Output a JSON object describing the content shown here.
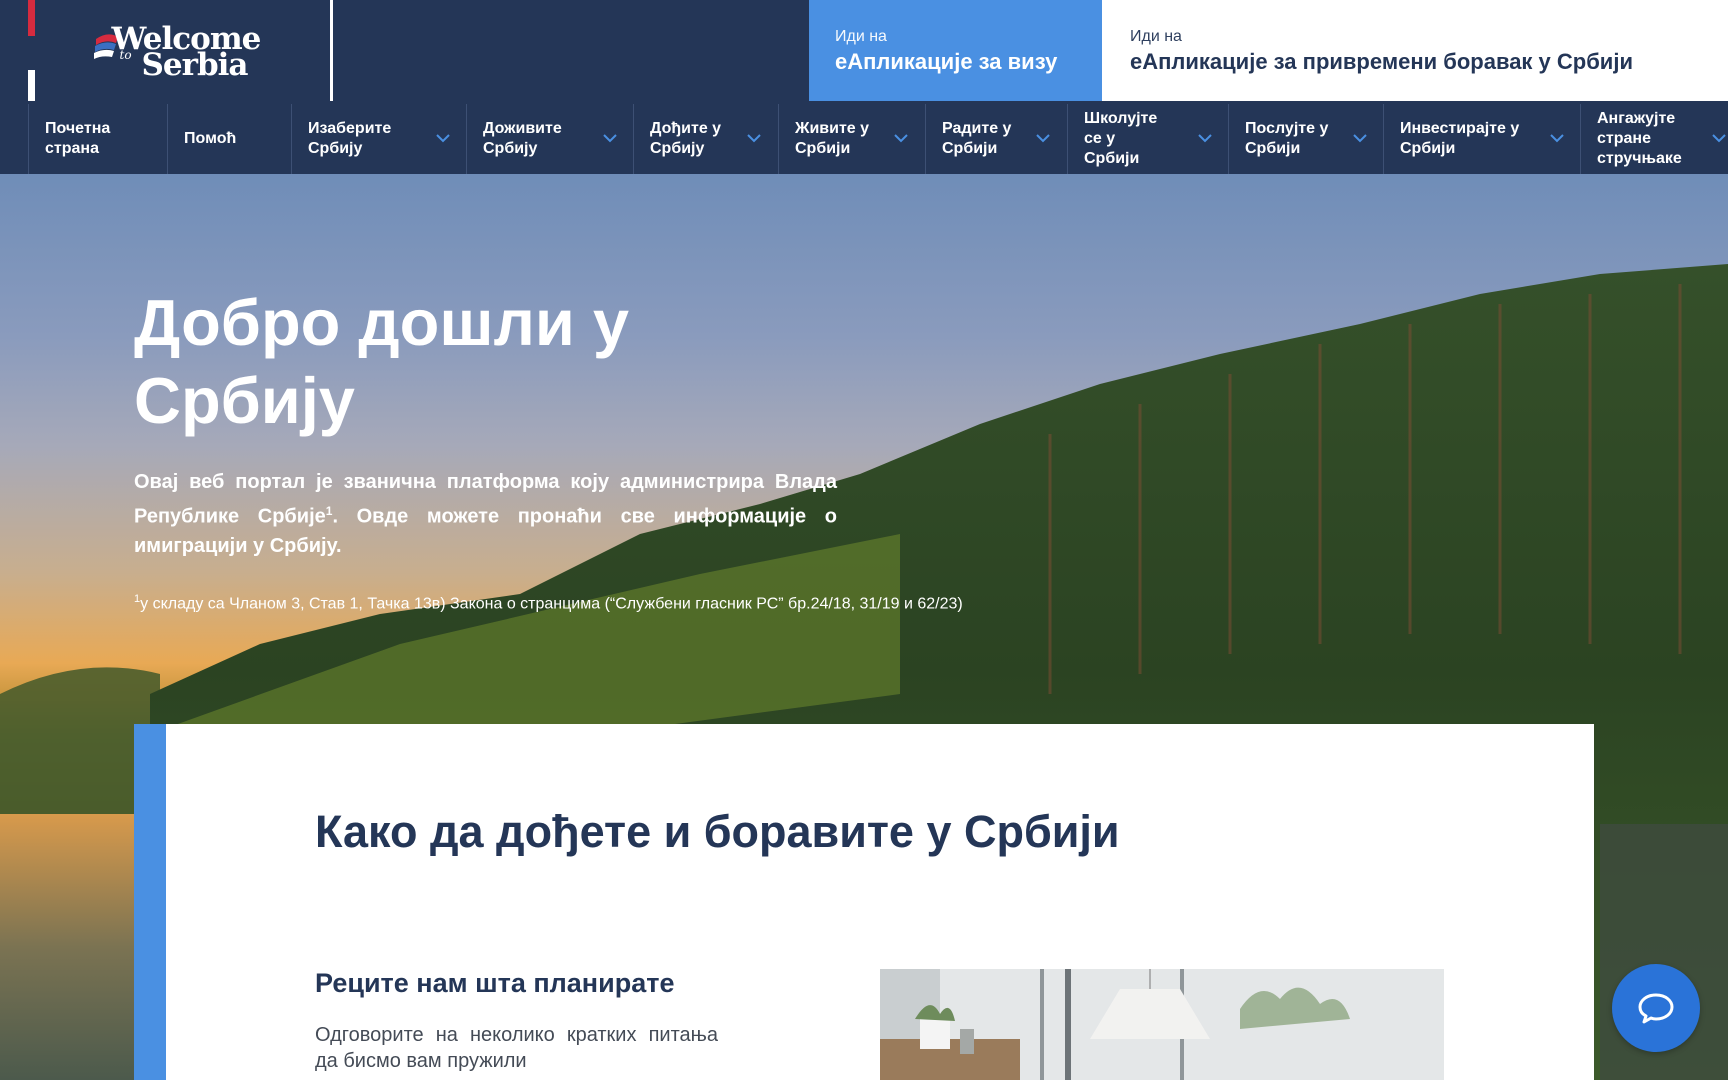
{
  "header": {
    "logo": {
      "line1": "Welcome",
      "line2": "to",
      "line3": "Serbia"
    },
    "visa_button": {
      "small": "Иди на",
      "big": "еАпликације за визу"
    },
    "stay_button": {
      "small": "Иди на",
      "big": "еАпликације за привремени боравак у Србији"
    }
  },
  "nav": {
    "items": [
      {
        "label": "Почетна страна",
        "dropdown": false
      },
      {
        "label": "Помоћ",
        "dropdown": false
      },
      {
        "label": "Изаберите Србију",
        "dropdown": true
      },
      {
        "label": "Доживите Србију",
        "dropdown": true
      },
      {
        "label": "Дођите у Србију",
        "dropdown": true
      },
      {
        "label": "Живите у Србији",
        "dropdown": true
      },
      {
        "label": "Радите у Србији",
        "dropdown": true
      },
      {
        "label": "Школујте се у Србији",
        "dropdown": true
      },
      {
        "label": "Послујте у Србији",
        "dropdown": true
      },
      {
        "label": "Инвестирајте у Србији",
        "dropdown": true
      },
      {
        "label": "Ангажујте стране стручњаке",
        "dropdown": true
      }
    ]
  },
  "hero": {
    "title": "Добро дошли у Србију",
    "text_part1": "Овај веб портал је званична платформа коју администрира Влада Републике Србије",
    "text_sup": "1",
    "text_part2": ". Овде можете пронаћи све информације о имиграцији у Србију.",
    "note_sup": "1",
    "note": "у складу са Чланом 3, Став 1, Тачка 13в) Закона о странцима (“Службени гласник РС” бр.24/18, 31/19 и 62/23)"
  },
  "card": {
    "title": "Како да дођете и боравите у Србији",
    "subtitle": "Реците нам шта планирате",
    "text": "Одговорите на неколико кратких питања да бисмо вам пружили"
  },
  "colors": {
    "navy": "#243657",
    "accent_blue": "#4a90e2",
    "chat_blue": "#2a73d8",
    "flag_red": "#d62b3f"
  },
  "icons": {
    "chat": "chat-bubble-icon",
    "dropdown": "chevron-down-icon"
  }
}
